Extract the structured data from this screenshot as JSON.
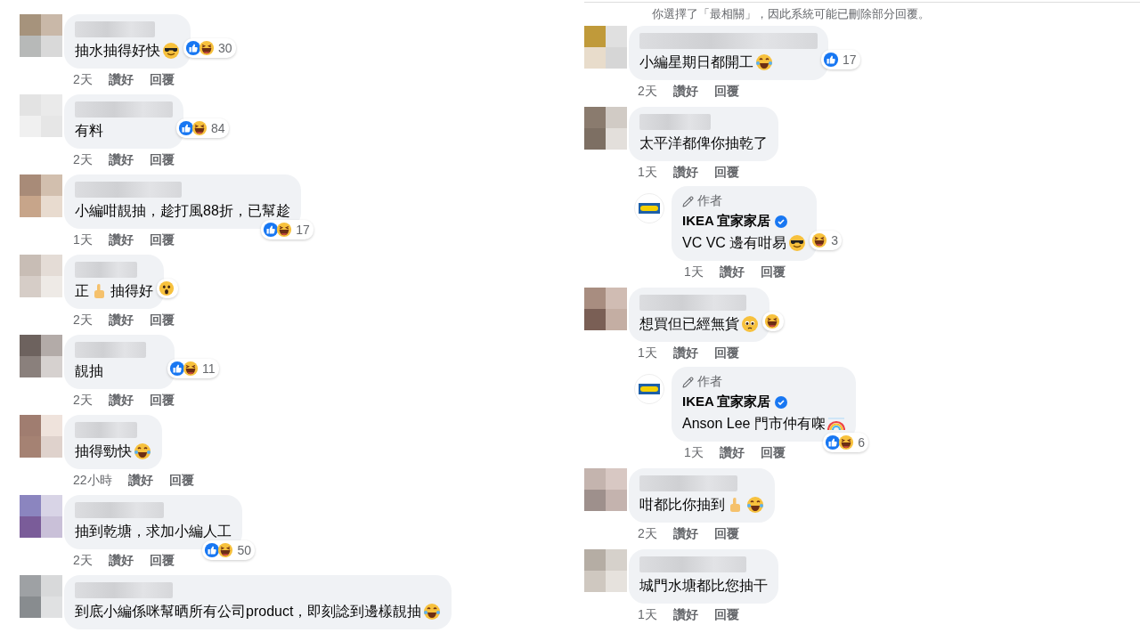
{
  "left_comments": [
    {
      "parts": [
        {
          "kind": "text",
          "text": "抽水抽得好快"
        },
        {
          "kind": "cool"
        }
      ],
      "reactions": {
        "items": [
          {
            "kind": "like"
          },
          {
            "kind": "haha"
          }
        ],
        "count": "30",
        "below": false
      },
      "time": "2天",
      "like_label": "讚好",
      "reply_label": "回覆"
    },
    {
      "parts": [
        {
          "kind": "text",
          "text": "有料"
        }
      ],
      "reactions": {
        "items": [
          {
            "kind": "like"
          },
          {
            "kind": "haha"
          }
        ],
        "count": "84",
        "below": false
      },
      "time": "2天",
      "like_label": "讚好",
      "reply_label": "回覆"
    },
    {
      "parts": [
        {
          "kind": "text",
          "text": "小編咁靚抽，趁打風88折，已幫趁"
        }
      ],
      "reactions": {
        "items": [
          {
            "kind": "like"
          },
          {
            "kind": "haha"
          }
        ],
        "count": "17",
        "below": true
      },
      "time": "1天",
      "like_label": "讚好",
      "reply_label": "回覆"
    },
    {
      "parts": [
        {
          "kind": "text",
          "text": "正"
        },
        {
          "kind": "thumb"
        },
        {
          "kind": "text",
          "text": "抽得好"
        }
      ],
      "reactions": {
        "items": [
          {
            "kind": "wow"
          }
        ],
        "below": false
      },
      "time": "2天",
      "like_label": "讚好",
      "reply_label": "回覆"
    },
    {
      "parts": [
        {
          "kind": "text",
          "text": "靚抽"
        }
      ],
      "reactions": {
        "items": [
          {
            "kind": "like"
          },
          {
            "kind": "haha"
          }
        ],
        "count": "11",
        "below": false
      },
      "time": "2天",
      "like_label": "讚好",
      "reply_label": "回覆"
    },
    {
      "parts": [
        {
          "kind": "text",
          "text": "抽得勁快"
        },
        {
          "kind": "tears"
        }
      ],
      "time": "22小時",
      "like_label": "讚好",
      "reply_label": "回覆"
    },
    {
      "parts": [
        {
          "kind": "text",
          "text": "抽到乾塘，求加小編人工"
        }
      ],
      "reactions": {
        "items": [
          {
            "kind": "like"
          },
          {
            "kind": "haha"
          }
        ],
        "count": "50",
        "below": true
      },
      "time": "2天",
      "like_label": "讚好",
      "reply_label": "回覆"
    },
    {
      "parts": [
        {
          "kind": "text",
          "text": "到底小編係咪幫晒所有公司product，即刻諗到邊樣靚抽"
        },
        {
          "kind": "tears"
        }
      ]
    }
  ],
  "notice": "你選擇了「最相關」，因此系統可能已刪除部分回覆。",
  "right_comments": [
    {
      "parts": [
        {
          "kind": "text",
          "text": "小編星期日都開工"
        },
        {
          "kind": "tears"
        }
      ],
      "reactions": {
        "items": [
          {
            "kind": "like"
          }
        ],
        "count": "17",
        "below": false
      },
      "time": "2天",
      "like_label": "讚好",
      "reply_label": "回覆"
    },
    {
      "parts": [
        {
          "kind": "text",
          "text": "太平洋都俾你抽乾了"
        }
      ],
      "time": "1天",
      "like_label": "讚好",
      "reply_label": "回覆",
      "replies": [
        {
          "badge": "作者",
          "name": "IKEA 宜家家居",
          "verified": true,
          "parts": [
            {
              "kind": "text",
              "text": "VC VC 邊有咁易"
            },
            {
              "kind": "cool"
            }
          ],
          "reactions": {
            "items": [
              {
                "kind": "haha"
              }
            ],
            "count": "3",
            "below": false
          },
          "time": "1天",
          "like_label": "讚好",
          "reply_label": "回覆"
        }
      ]
    },
    {
      "parts": [
        {
          "kind": "text",
          "text": "想買但已經無貨"
        },
        {
          "kind": "teary"
        }
      ],
      "reactions": {
        "items": [
          {
            "kind": "haha"
          }
        ],
        "below": false
      },
      "time": "1天",
      "like_label": "讚好",
      "reply_label": "回覆",
      "replies": [
        {
          "badge": "作者",
          "name": "IKEA 宜家家居",
          "verified": true,
          "parts": [
            {
              "kind": "text",
              "text": "Anson Lee 門市仲有㗎"
            },
            {
              "kind": "rainbow"
            }
          ],
          "reactions": {
            "items": [
              {
                "kind": "like"
              },
              {
                "kind": "haha"
              }
            ],
            "count": "6",
            "below": true
          },
          "time": "1天",
          "like_label": "讚好",
          "reply_label": "回覆"
        }
      ]
    },
    {
      "parts": [
        {
          "kind": "text",
          "text": "咁都比你抽到"
        },
        {
          "kind": "thumb"
        },
        {
          "kind": "tears"
        }
      ],
      "time": "2天",
      "like_label": "讚好",
      "reply_label": "回覆"
    },
    {
      "parts": [
        {
          "kind": "text",
          "text": "城門水塘都比您抽干"
        }
      ],
      "time": "1天",
      "like_label": "讚好",
      "reply_label": "回覆"
    }
  ]
}
